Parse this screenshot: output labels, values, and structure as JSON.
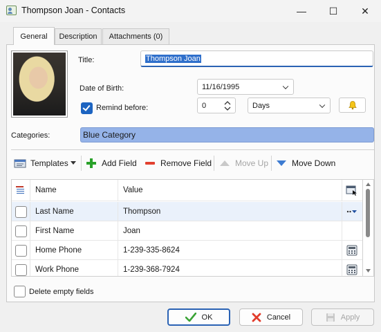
{
  "window": {
    "title": "Thompson Joan - Contacts",
    "minimize_glyph": "—",
    "maximize_glyph": "☐",
    "close_glyph": "✕"
  },
  "tabs": [
    {
      "label": "General",
      "active": true
    },
    {
      "label": "Description",
      "active": false
    },
    {
      "label": "Attachments (0)",
      "active": false
    }
  ],
  "form": {
    "title_label": "Title:",
    "title_value": "Thompson Joan",
    "dob_label": "Date of Birth:",
    "dob_value": "11/16/1995",
    "remind_label": "Remind before:",
    "remind_checked": true,
    "remind_count": "0",
    "remind_unit": "Days",
    "categories_label": "Categories:",
    "category_value": "Blue Category"
  },
  "toolbar": {
    "templates": "Templates",
    "add_field": "Add Field",
    "remove_field": "Remove Field",
    "move_up": "Move Up",
    "move_down": "Move Down"
  },
  "grid": {
    "columns": [
      "Name",
      "Value"
    ],
    "rows": [
      {
        "name": "Last Name",
        "value": "Thompson",
        "selected": true
      },
      {
        "name": "First Name",
        "value": "Joan",
        "selected": false
      },
      {
        "name": "Home Phone",
        "value": "1-239-335-8624",
        "selected": false
      },
      {
        "name": "Work Phone",
        "value": "1-239-368-7924",
        "selected": false
      }
    ]
  },
  "delete_empty_label": "Delete empty fields",
  "buttons": {
    "ok": "OK",
    "cancel": "Cancel",
    "apply": "Apply"
  },
  "colors": {
    "accent": "#2a62b4",
    "category": "#95b3e8",
    "selected_row": "#eaf1fb"
  }
}
